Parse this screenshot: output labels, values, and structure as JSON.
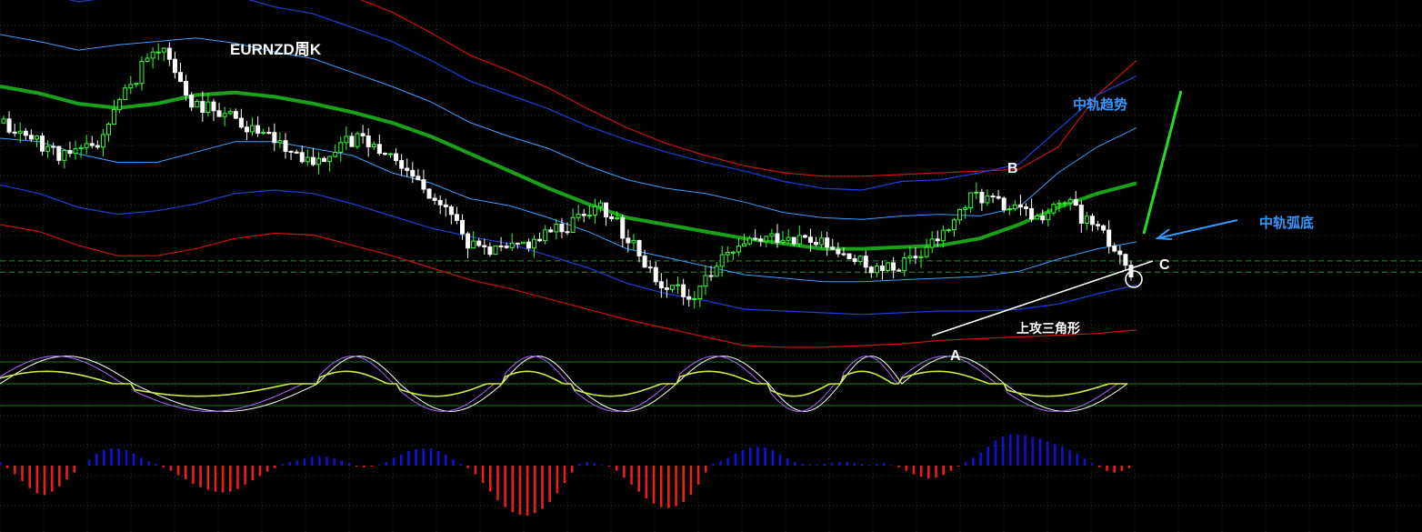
{
  "chart_data": {
    "type": "candlestick",
    "title": "EURNZD周K",
    "annotations": {
      "point_a": "A",
      "point_b": "B",
      "point_c": "C",
      "pattern": "上攻三角形",
      "mid_trend": "中轨趋势",
      "mid_arc_bottom": "中轨弧底"
    },
    "price_range": [
      1.5,
      1.9
    ],
    "horizontal_levels": [
      1.598,
      1.585
    ],
    "bollinger": {
      "mid": [
        1.8,
        1.792,
        1.78,
        1.775,
        1.78,
        1.79,
        1.793,
        1.788,
        1.78,
        1.77,
        1.758,
        1.742,
        1.722,
        1.702,
        1.682,
        1.664,
        1.648,
        1.64,
        1.632,
        1.624,
        1.618,
        1.612,
        1.612,
        1.614,
        1.616,
        1.624,
        1.64,
        1.66,
        1.676,
        1.688
      ],
      "inner_upper": [
        1.86,
        1.852,
        1.842,
        1.848,
        1.852,
        1.856,
        1.85,
        1.84,
        1.832,
        1.816,
        1.8,
        1.782,
        1.758,
        1.742,
        1.728,
        1.708,
        1.692,
        1.682,
        1.676,
        1.666,
        1.654,
        1.648,
        1.646,
        1.65,
        1.652,
        1.65,
        1.66,
        1.7,
        1.73,
        1.752
      ],
      "inner_lower": [
        1.74,
        1.736,
        1.722,
        1.712,
        1.712,
        1.724,
        1.736,
        1.736,
        1.728,
        1.72,
        1.7,
        1.688,
        1.67,
        1.662,
        1.648,
        1.632,
        1.612,
        1.602,
        1.592,
        1.582,
        1.578,
        1.574,
        1.574,
        1.576,
        1.578,
        1.58,
        1.586,
        1.6,
        1.612,
        1.62
      ],
      "outer_upper": [
        1.912,
        1.908,
        1.898,
        1.904,
        1.908,
        1.912,
        1.905,
        1.892,
        1.884,
        1.868,
        1.852,
        1.83,
        1.806,
        1.79,
        1.774,
        1.754,
        1.738,
        1.724,
        1.712,
        1.702,
        1.69,
        1.682,
        1.68,
        1.69,
        1.692,
        1.7,
        1.71,
        1.75,
        1.79,
        1.812
      ],
      "outer_lower": [
        1.686,
        1.676,
        1.66,
        1.652,
        1.656,
        1.664,
        1.676,
        1.68,
        1.676,
        1.664,
        1.65,
        1.636,
        1.626,
        1.618,
        1.604,
        1.59,
        1.572,
        1.56,
        1.552,
        1.542,
        1.54,
        1.538,
        1.536,
        1.538,
        1.54,
        1.54,
        1.542,
        1.548,
        1.56,
        1.57
      ],
      "red_upper": [
        1.96,
        1.952,
        1.94,
        1.946,
        1.95,
        1.954,
        1.946,
        1.932,
        1.922,
        1.904,
        1.886,
        1.862,
        1.836,
        1.818,
        1.798,
        1.774,
        1.752,
        1.734,
        1.72,
        1.708,
        1.7,
        1.696,
        1.696,
        1.698,
        1.7,
        1.702,
        1.704,
        1.73,
        1.79,
        1.83
      ],
      "red_lower": [
        1.64,
        1.632,
        1.616,
        1.604,
        1.604,
        1.612,
        1.624,
        1.63,
        1.628,
        1.616,
        1.604,
        1.59,
        1.576,
        1.566,
        1.554,
        1.542,
        1.53,
        1.52,
        1.51,
        1.5,
        1.498,
        1.498,
        1.5,
        1.502,
        1.506,
        1.508,
        1.51,
        1.512,
        1.514,
        1.518
      ]
    },
    "price_path": [
      1.755,
      1.738,
      1.718,
      1.735,
      1.8,
      1.85,
      1.78,
      1.772,
      1.75,
      1.73,
      1.712,
      1.74,
      1.73,
      1.7,
      1.665,
      1.612,
      1.61,
      1.625,
      1.64,
      1.668,
      1.62,
      1.572,
      1.56,
      1.6,
      1.62,
      1.628,
      1.618,
      1.6,
      1.585,
      1.598,
      1.628,
      1.675,
      1.66,
      1.648,
      1.665,
      1.63,
      1.588
    ],
    "oscillator": {
      "range": [
        0,
        100
      ],
      "levels": [
        80,
        50,
        20
      ],
      "waves": [
        [
          0.13,
          6
        ],
        [
          0.18,
          -5
        ],
        [
          0.08,
          7
        ],
        [
          0.1,
          -6
        ],
        [
          0.07,
          6
        ],
        [
          0.1,
          -5
        ],
        [
          0.09,
          4
        ],
        [
          0.07,
          -4
        ],
        [
          0.06,
          3
        ],
        [
          0.1,
          7
        ],
        [
          0.12,
          -5
        ]
      ]
    },
    "histogram": {
      "colors": {
        "positive": "#1010dd",
        "negative": "#ee1c1c"
      },
      "bars": [
        4,
        -3,
        -10,
        -18,
        -26,
        -32,
        -34,
        -30,
        -24,
        -16,
        -8,
        0,
        7,
        14,
        18,
        20,
        20,
        18,
        14,
        9,
        5,
        2,
        -2,
        -6,
        -11,
        -16,
        -21,
        -25,
        -28,
        -30,
        -31,
        -30,
        -27,
        -22,
        -17,
        -12,
        -7,
        -3,
        2,
        4,
        6,
        8,
        10,
        11,
        10,
        8,
        6,
        3,
        -1,
        -2,
        -1,
        1,
        4,
        9,
        13,
        17,
        19,
        20,
        20,
        17,
        13,
        7,
        2,
        -3,
        -10,
        -20,
        -30,
        -40,
        -48,
        -54,
        -57,
        -58,
        -55,
        -50,
        -42,
        -32,
        -20,
        -8,
        2,
        4,
        3,
        1,
        -1,
        -6,
        -14,
        -22,
        -30,
        -38,
        -44,
        -48,
        -49,
        -47,
        -42,
        -34,
        -22,
        -8,
        2,
        5,
        9,
        14,
        18,
        21,
        22,
        21,
        18,
        13,
        8,
        4,
        2,
        1,
        1,
        2,
        3,
        4,
        4,
        3,
        2,
        1,
        2,
        3,
        1,
        -2,
        -6,
        -10,
        -13,
        -15,
        -14,
        -11,
        -6,
        -1,
        4,
        9,
        15,
        22,
        29,
        34,
        36,
        36,
        35,
        33,
        31,
        28,
        25,
        22,
        18,
        14,
        8,
        3,
        -2,
        -6,
        -8,
        -6,
        -3
      ]
    }
  }
}
